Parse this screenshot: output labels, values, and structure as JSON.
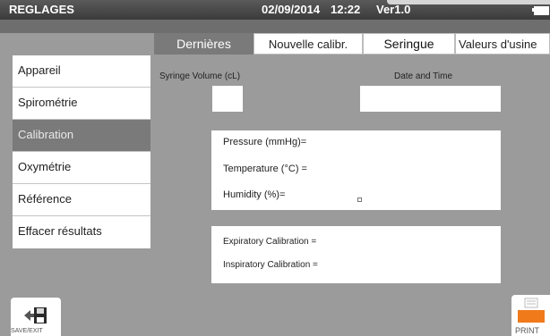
{
  "header": {
    "title": "REGLAGES",
    "date": "02/09/2014",
    "time": "12:22",
    "version": "Ver1.0",
    "battery_icon": "battery-icon"
  },
  "tabs": [
    {
      "label": "Dernières",
      "active": true
    },
    {
      "label": "Nouvelle calibr."
    },
    {
      "label": "Seringue"
    },
    {
      "label": "Valeurs d'usine"
    }
  ],
  "sidebar": {
    "items": [
      {
        "label": "Appareil"
      },
      {
        "label": "Spirométrie"
      },
      {
        "label": "Calibration",
        "selected": true
      },
      {
        "label": "Oxymétrie"
      },
      {
        "label": "Référence"
      },
      {
        "label": "Effacer résultats"
      }
    ]
  },
  "main": {
    "syringe_volume_label": "Syringe Volume (cL)",
    "syringe_volume_value": "",
    "date_time_label": "Date and Time",
    "date_time_value": "",
    "conditions": {
      "pressure": "Pressure (mmHg)=",
      "temperature": "Temperature (°C) =",
      "humidity": "Humidity (%)="
    },
    "calibration": {
      "expiratory": "Expiratory Calibration =",
      "inspiratory": "Inspiratory Calibration ="
    }
  },
  "footer": {
    "save_label": "SAVE/EXIT",
    "print_label": "PRINT",
    "colors": {
      "print_accent": "#f07a1a",
      "save_icon": "#2a2a2a"
    }
  }
}
